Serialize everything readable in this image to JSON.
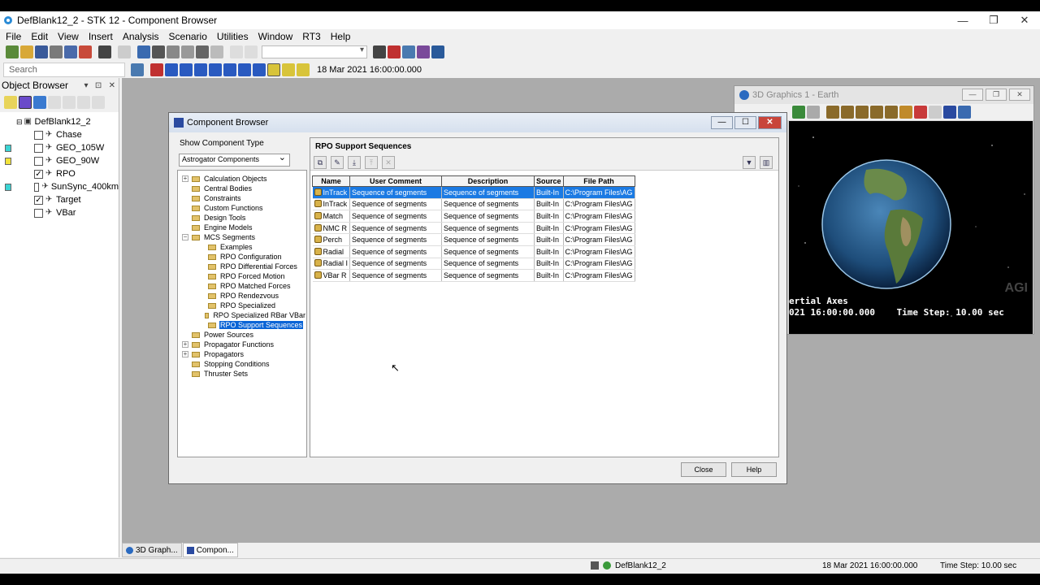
{
  "app": {
    "title": "DefBlank12_2 - STK 12 - Component Browser",
    "window_controls": [
      "minimize",
      "restore",
      "close"
    ]
  },
  "menu": [
    "File",
    "Edit",
    "View",
    "Insert",
    "Analysis",
    "Scenario",
    "Utilities",
    "Window",
    "RT3",
    "Help"
  ],
  "toolbar": {
    "search_placeholder": "Search",
    "time_value": "18 Mar 2021 16:00:00.000"
  },
  "object_browser": {
    "title": "Object Browser",
    "root": "DefBlank12_2",
    "items": [
      {
        "label": "Chase",
        "checked": false,
        "swatch": ""
      },
      {
        "label": "GEO_105W",
        "checked": false,
        "swatch": "#3ad4d4"
      },
      {
        "label": "GEO_90W",
        "checked": false,
        "swatch": "#f2e33a"
      },
      {
        "label": "RPO",
        "checked": true,
        "swatch": ""
      },
      {
        "label": "SunSync_400km",
        "checked": false,
        "swatch": "#3ad4d4"
      },
      {
        "label": "Target",
        "checked": true,
        "swatch": ""
      },
      {
        "label": "VBar",
        "checked": false,
        "swatch": ""
      }
    ]
  },
  "graphics_window": {
    "title": "3D Graphics 1 - Earth",
    "hud_line1": "ertial Axes",
    "hud_line2": "021 16:00:00.000    Time Step: 10.00 sec",
    "watermark": "AGI"
  },
  "component_browser": {
    "title": "Component Browser",
    "show_type_label": "Show Component Type",
    "type_selected": "Astrogator Components",
    "tree": [
      {
        "label": "Calculation Objects",
        "level": 0,
        "exp": "+"
      },
      {
        "label": "Central Bodies",
        "level": 0,
        "exp": ""
      },
      {
        "label": "Constraints",
        "level": 0,
        "exp": ""
      },
      {
        "label": "Custom Functions",
        "level": 0,
        "exp": ""
      },
      {
        "label": "Design Tools",
        "level": 0,
        "exp": ""
      },
      {
        "label": "Engine Models",
        "level": 0,
        "exp": ""
      },
      {
        "label": "MCS Segments",
        "level": 0,
        "exp": "−"
      },
      {
        "label": "Examples",
        "level": 1,
        "exp": ""
      },
      {
        "label": "RPO Configuration",
        "level": 1,
        "exp": ""
      },
      {
        "label": "RPO Differential Forces",
        "level": 1,
        "exp": ""
      },
      {
        "label": "RPO Forced Motion",
        "level": 1,
        "exp": ""
      },
      {
        "label": "RPO Matched Forces",
        "level": 1,
        "exp": ""
      },
      {
        "label": "RPO Rendezvous",
        "level": 1,
        "exp": ""
      },
      {
        "label": "RPO Specialized",
        "level": 1,
        "exp": ""
      },
      {
        "label": "RPO Specialized RBar VBar",
        "level": 1,
        "exp": ""
      },
      {
        "label": "RPO Support Sequences",
        "level": 1,
        "exp": "",
        "selected": true
      },
      {
        "label": "Power Sources",
        "level": 0,
        "exp": ""
      },
      {
        "label": "Propagator Functions",
        "level": 0,
        "exp": "+"
      },
      {
        "label": "Propagators",
        "level": 0,
        "exp": "+"
      },
      {
        "label": "Stopping Conditions",
        "level": 0,
        "exp": ""
      },
      {
        "label": "Thruster Sets",
        "level": 0,
        "exp": ""
      }
    ],
    "panel_title": "RPO Support Sequences",
    "columns": [
      "Name",
      "User Comment",
      "Description",
      "Source",
      "File Path"
    ],
    "rows": [
      [
        "InTrack",
        "Sequence of segments",
        "Sequence of segments",
        "Built-In",
        "C:\\Program Files\\AG"
      ],
      [
        "InTrack",
        "Sequence of segments",
        "Sequence of segments",
        "Built-In",
        "C:\\Program Files\\AG"
      ],
      [
        "Match",
        "Sequence of segments",
        "Sequence of segments",
        "Built-In",
        "C:\\Program Files\\AG"
      ],
      [
        "NMC R",
        "Sequence of segments",
        "Sequence of segments",
        "Built-In",
        "C:\\Program Files\\AG"
      ],
      [
        "Perch",
        "Sequence of segments",
        "Sequence of segments",
        "Built-In",
        "C:\\Program Files\\AG"
      ],
      [
        "Radial",
        "Sequence of segments",
        "Sequence of segments",
        "Built-In",
        "C:\\Program Files\\AG"
      ],
      [
        "Radial I",
        "Sequence of segments",
        "Sequence of segments",
        "Built-In",
        "C:\\Program Files\\AG"
      ],
      [
        "VBar R",
        "Sequence of segments",
        "Sequence of segments",
        "Built-In",
        "C:\\Program Files\\AG"
      ]
    ],
    "close_label": "Close",
    "help_label": "Help"
  },
  "taskbar": [
    {
      "label": "3D Graph..."
    },
    {
      "label": "Compon..."
    }
  ],
  "status": {
    "scenario": "DefBlank12_2",
    "time": "18 Mar 2021 16:00:00.000",
    "time_step": "Time Step: 10.00 sec"
  }
}
